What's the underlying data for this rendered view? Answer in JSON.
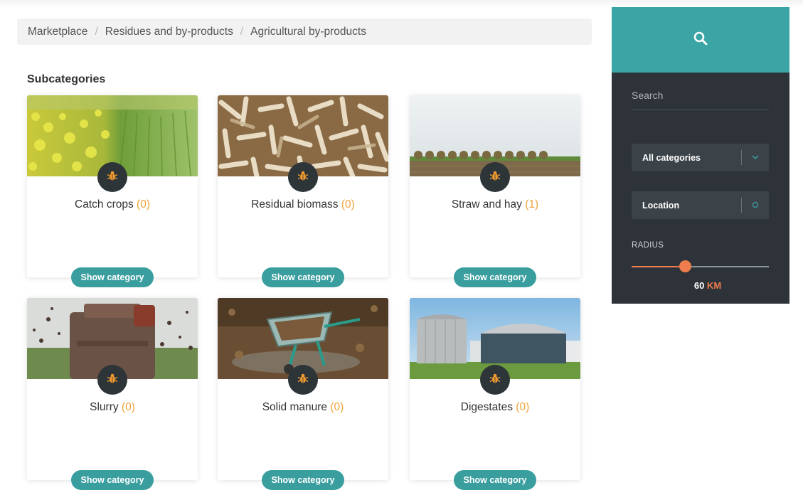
{
  "breadcrumb": {
    "items": [
      "Marketplace",
      "Residues and by-products",
      "Agricultural by-products"
    ],
    "separator": "/"
  },
  "subcategories_heading": "Subcategories",
  "cards": [
    {
      "name": "Catch crops",
      "count": "(0)",
      "button": "Show category",
      "icon": "bug-icon"
    },
    {
      "name": "Residual biomass",
      "count": "(0)",
      "button": "Show category",
      "icon": "bug-icon"
    },
    {
      "name": "Straw and hay",
      "count": "(1)",
      "button": "Show category",
      "icon": "bug-icon"
    },
    {
      "name": "Slurry",
      "count": "(0)",
      "button": "Show category",
      "icon": "bug-icon"
    },
    {
      "name": "Solid manure",
      "count": "(0)",
      "button": "Show category",
      "icon": "bug-icon"
    },
    {
      "name": "Digestates",
      "count": "(0)",
      "button": "Show category",
      "icon": "bug-icon"
    }
  ],
  "sidebar": {
    "search_icon": "search-icon",
    "search_placeholder": "Search",
    "category_select": "All categories",
    "location_select": "Location",
    "radius_label": "RADIUS",
    "radius_value": "60",
    "radius_unit": "KM",
    "radius_fraction": 0.4
  },
  "colors": {
    "accent": "#3aa5a4",
    "button": "#3a9e9f",
    "sidebar_bg": "#2d3338",
    "count": "#f0a33a",
    "slider": "#ef7d4d",
    "badge_icon": "#f29a2e"
  }
}
